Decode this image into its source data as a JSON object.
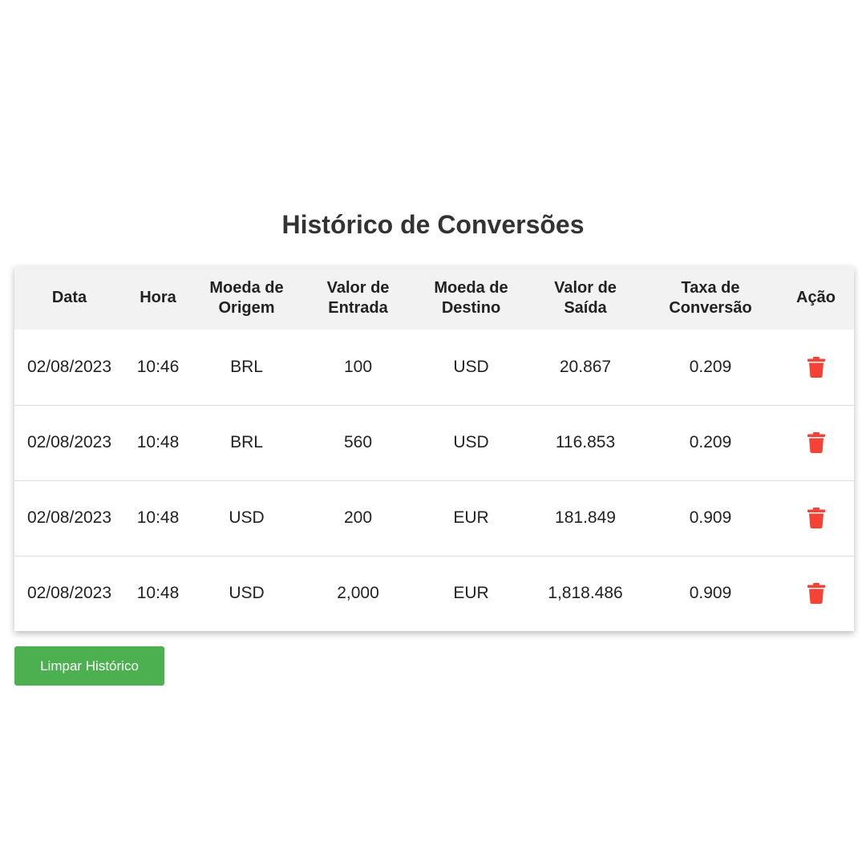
{
  "title": "Histórico de Conversões",
  "table": {
    "headers": [
      [
        "Data"
      ],
      [
        "Hora"
      ],
      [
        "Moeda de",
        "Origem"
      ],
      [
        "Valor de",
        "Entrada"
      ],
      [
        "Moeda de",
        "Destino"
      ],
      [
        "Valor de",
        "Saída"
      ],
      [
        "Taxa de",
        "Conversão"
      ],
      [
        "Ação"
      ]
    ],
    "rows": [
      {
        "data": "02/08/2023",
        "hora": "10:46",
        "origem": "BRL",
        "entrada": "100",
        "destino": "USD",
        "saida": "20.867",
        "taxa": "0.209",
        "acao_icon": "trash-icon"
      },
      {
        "data": "02/08/2023",
        "hora": "10:48",
        "origem": "BRL",
        "entrada": "560",
        "destino": "USD",
        "saida": "116.853",
        "taxa": "0.209",
        "acao_icon": "trash-icon"
      },
      {
        "data": "02/08/2023",
        "hora": "10:48",
        "origem": "USD",
        "entrada": "200",
        "destino": "EUR",
        "saida": "181.849",
        "taxa": "0.909",
        "acao_icon": "trash-icon"
      },
      {
        "data": "02/08/2023",
        "hora": "10:48",
        "origem": "USD",
        "entrada": "2,000",
        "destino": "EUR",
        "saida": "1,818.486",
        "taxa": "0.909",
        "acao_icon": "trash-icon"
      }
    ]
  },
  "clear_button": {
    "label": "Limpar Histórico"
  },
  "colors": {
    "header_bg": "#f2f2f2",
    "trash": "#f44336",
    "button_bg": "#4caf50",
    "button_text": "#ffffff"
  }
}
